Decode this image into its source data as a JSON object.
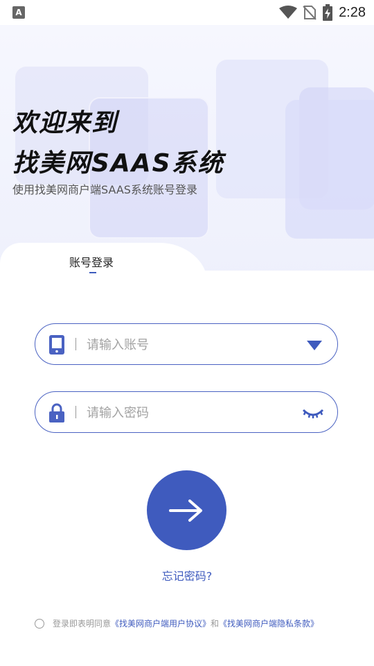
{
  "status_bar": {
    "app_icon_letter": "A",
    "time": "2:28",
    "icons": [
      "wifi-icon",
      "no-sim-icon",
      "battery-charging-icon"
    ]
  },
  "hero": {
    "title_line1": "欢迎来到",
    "title_line2": "找美网SAAS系统",
    "subtitle": "使用找美网商户端SAAS系统账号登录"
  },
  "login_tab": {
    "label": "账号登录"
  },
  "account_field": {
    "icon": "phone-icon",
    "placeholder": "请输入账号",
    "value": "",
    "trailing_icon": "dropdown-triangle-icon"
  },
  "password_field": {
    "icon": "lock-icon",
    "placeholder": "请输入密码",
    "value": "",
    "trailing_icon": "eye-closed-icon"
  },
  "submit": {
    "icon": "arrow-right-icon"
  },
  "forgot_password": "忘记密码?",
  "agreement": {
    "prefix": "登录即表明同意",
    "user_agreement": "《找美网商户端用户协议》",
    "joiner": "和",
    "privacy_policy": "《找美网商户端隐私条款》",
    "checked": false
  },
  "colors": {
    "accent": "#3f5bbe",
    "hero_bg": "#f1f3fd",
    "text_dark": "#111111",
    "placeholder": "#a2a2a2"
  }
}
